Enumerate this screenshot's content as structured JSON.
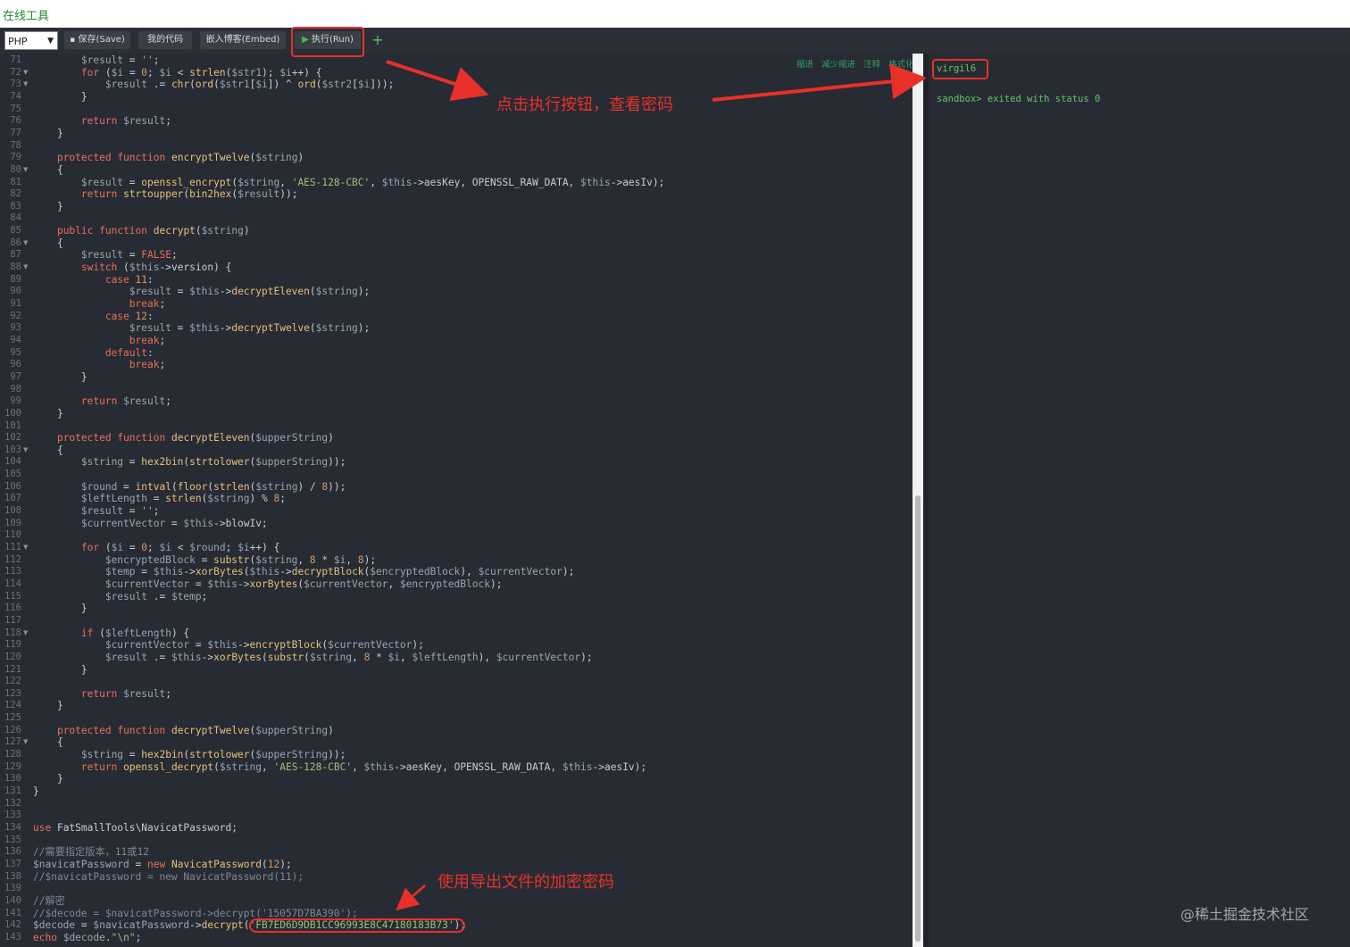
{
  "app": {
    "title": "在线工具"
  },
  "toolbar": {
    "language": "PHP",
    "save_label": "保存(Save)",
    "mycode_label": "我的代码",
    "embed_label": "嵌入博客(Embed)",
    "run_label": "执行(Run)",
    "add_label": "+"
  },
  "editor_toolbar": [
    "缩进",
    "减少缩进",
    "注释",
    "格式化"
  ],
  "editor": {
    "lines": [
      {
        "n": "71",
        "fold": false,
        "t": "        $result = '';"
      },
      {
        "n": "72",
        "fold": true,
        "t": "        for ($i = 0; $i < strlen($str1); $i++) {"
      },
      {
        "n": "73",
        "fold": true,
        "t": "            $result .= chr(ord($str1[$i]) ^ ord($str2[$i]));"
      },
      {
        "n": "74",
        "fold": false,
        "t": "        }"
      },
      {
        "n": "75",
        "fold": false,
        "t": ""
      },
      {
        "n": "76",
        "fold": false,
        "t": "        return $result;"
      },
      {
        "n": "77",
        "fold": false,
        "t": "    }"
      },
      {
        "n": "78",
        "fold": false,
        "t": ""
      },
      {
        "n": "79",
        "fold": false,
        "t": "    protected function encryptTwelve($string)"
      },
      {
        "n": "80",
        "fold": true,
        "t": "    {"
      },
      {
        "n": "81",
        "fold": false,
        "t": "        $result = openssl_encrypt($string, 'AES-128-CBC', $this->aesKey, OPENSSL_RAW_DATA, $this->aesIv);"
      },
      {
        "n": "82",
        "fold": false,
        "t": "        return strtoupper(bin2hex($result));"
      },
      {
        "n": "83",
        "fold": false,
        "t": "    }"
      },
      {
        "n": "84",
        "fold": false,
        "t": ""
      },
      {
        "n": "85",
        "fold": false,
        "t": "    public function decrypt($string)"
      },
      {
        "n": "86",
        "fold": true,
        "t": "    {"
      },
      {
        "n": "87",
        "fold": false,
        "t": "        $result = FALSE;"
      },
      {
        "n": "88",
        "fold": true,
        "t": "        switch ($this->version) {"
      },
      {
        "n": "89",
        "fold": false,
        "t": "            case 11:"
      },
      {
        "n": "90",
        "fold": false,
        "t": "                $result = $this->decryptEleven($string);"
      },
      {
        "n": "91",
        "fold": false,
        "t": "                break;"
      },
      {
        "n": "92",
        "fold": false,
        "t": "            case 12:"
      },
      {
        "n": "93",
        "fold": false,
        "t": "                $result = $this->decryptTwelve($string);"
      },
      {
        "n": "94",
        "fold": false,
        "t": "                break;"
      },
      {
        "n": "95",
        "fold": false,
        "t": "            default:"
      },
      {
        "n": "96",
        "fold": false,
        "t": "                break;"
      },
      {
        "n": "97",
        "fold": false,
        "t": "        }"
      },
      {
        "n": "98",
        "fold": false,
        "t": ""
      },
      {
        "n": "99",
        "fold": false,
        "t": "        return $result;"
      },
      {
        "n": "100",
        "fold": false,
        "t": "    }"
      },
      {
        "n": "101",
        "fold": false,
        "t": ""
      },
      {
        "n": "102",
        "fold": false,
        "t": "    protected function decryptEleven($upperString)"
      },
      {
        "n": "103",
        "fold": true,
        "t": "    {"
      },
      {
        "n": "104",
        "fold": false,
        "t": "        $string = hex2bin(strtolower($upperString));"
      },
      {
        "n": "105",
        "fold": false,
        "t": ""
      },
      {
        "n": "106",
        "fold": false,
        "t": "        $round = intval(floor(strlen($string) / 8));"
      },
      {
        "n": "107",
        "fold": false,
        "t": "        $leftLength = strlen($string) % 8;"
      },
      {
        "n": "108",
        "fold": false,
        "t": "        $result = '';"
      },
      {
        "n": "109",
        "fold": false,
        "t": "        $currentVector = $this->blowIv;"
      },
      {
        "n": "110",
        "fold": false,
        "t": ""
      },
      {
        "n": "111",
        "fold": true,
        "t": "        for ($i = 0; $i < $round; $i++) {"
      },
      {
        "n": "112",
        "fold": false,
        "t": "            $encryptedBlock = substr($string, 8 * $i, 8);"
      },
      {
        "n": "113",
        "fold": false,
        "t": "            $temp = $this->xorBytes($this->decryptBlock($encryptedBlock), $currentVector);"
      },
      {
        "n": "114",
        "fold": false,
        "t": "            $currentVector = $this->xorBytes($currentVector, $encryptedBlock);"
      },
      {
        "n": "115",
        "fold": false,
        "t": "            $result .= $temp;"
      },
      {
        "n": "116",
        "fold": false,
        "t": "        }"
      },
      {
        "n": "117",
        "fold": false,
        "t": ""
      },
      {
        "n": "118",
        "fold": true,
        "t": "        if ($leftLength) {"
      },
      {
        "n": "119",
        "fold": false,
        "t": "            $currentVector = $this->encryptBlock($currentVector);"
      },
      {
        "n": "120",
        "fold": false,
        "t": "            $result .= $this->xorBytes(substr($string, 8 * $i, $leftLength), $currentVector);"
      },
      {
        "n": "121",
        "fold": false,
        "t": "        }"
      },
      {
        "n": "122",
        "fold": false,
        "t": ""
      },
      {
        "n": "123",
        "fold": false,
        "t": "        return $result;"
      },
      {
        "n": "124",
        "fold": false,
        "t": "    }"
      },
      {
        "n": "125",
        "fold": false,
        "t": ""
      },
      {
        "n": "126",
        "fold": false,
        "t": "    protected function decryptTwelve($upperString)"
      },
      {
        "n": "127",
        "fold": true,
        "t": "    {"
      },
      {
        "n": "128",
        "fold": false,
        "t": "        $string = hex2bin(strtolower($upperString));"
      },
      {
        "n": "129",
        "fold": false,
        "t": "        return openssl_decrypt($string, 'AES-128-CBC', $this->aesKey, OPENSSL_RAW_DATA, $this->aesIv);"
      },
      {
        "n": "130",
        "fold": false,
        "t": "    }"
      },
      {
        "n": "131",
        "fold": false,
        "t": "}"
      },
      {
        "n": "132",
        "fold": false,
        "t": ""
      },
      {
        "n": "133",
        "fold": false,
        "t": ""
      },
      {
        "n": "134",
        "fold": false,
        "t": "use FatSmallTools\\NavicatPassword;"
      },
      {
        "n": "135",
        "fold": false,
        "t": ""
      },
      {
        "n": "136",
        "fold": false,
        "t": "//需要指定版本，11或12"
      },
      {
        "n": "137",
        "fold": false,
        "t": "$navicatPassword = new NavicatPassword(12);"
      },
      {
        "n": "138",
        "fold": false,
        "t": "//$navicatPassword = new NavicatPassword(11);"
      },
      {
        "n": "139",
        "fold": false,
        "t": ""
      },
      {
        "n": "140",
        "fold": false,
        "t": "//解密"
      },
      {
        "n": "141",
        "fold": false,
        "t": "//$decode = $navicatPassword->decrypt('15057D7BA390');"
      },
      {
        "n": "142",
        "fold": false,
        "t": "$decode = $navicatPassword->decrypt('FB7ED6D9DB1CC96993E8C47180183B73');"
      },
      {
        "n": "143",
        "fold": false,
        "t": "echo $decode.\"\\n\";"
      }
    ]
  },
  "output": {
    "result": "virgil6",
    "status": "sandbox> exited with status 0"
  },
  "annotations": {
    "run_hint": "点击执行按钮，查看密码",
    "encrypted_hint": "使用导出文件的加密密码"
  },
  "watermark": "@稀土掘金技术社区",
  "colors": {
    "annotation_red": "#e8302a",
    "output_green": "#68c26a",
    "editor_bg": "#272b33"
  }
}
